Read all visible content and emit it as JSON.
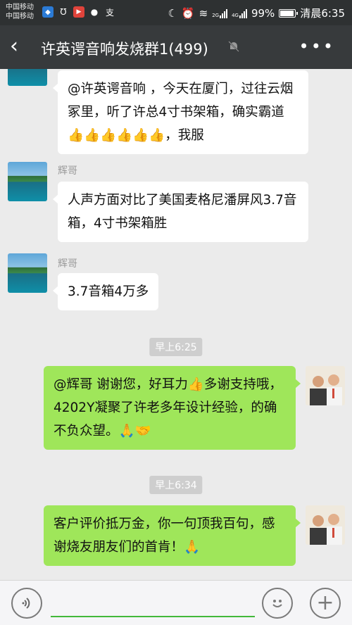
{
  "status_bar": {
    "carrier1": "中国移动",
    "carrier2": "中国移动",
    "left_icons": [
      "shield-icon",
      "spy-icon",
      "video-icon",
      "chat-icon",
      "alipay-icon"
    ],
    "net1": "2G",
    "net2": "4G",
    "battery": "99%",
    "battery_level": 0.99,
    "time": "清晨6:35"
  },
  "title_bar": {
    "back_icon": "back-arrow-icon",
    "title": "许英谔音响发烧群1(499)",
    "mute_icon": "mute-bell-icon",
    "more_icon": "more-dots-icon"
  },
  "messages": [
    {
      "type": "left",
      "sender": "",
      "text": "@许英谔音响 ，今天在厦门，过往云烟冢里，听了许总4寸书架箱，确实霸道👍👍👍👍👍👍，我服"
    },
    {
      "type": "left",
      "sender": "辉哥",
      "text": "人声方面对比了美国麦格尼潘屏风3.7音箱，4寸书架箱胜"
    },
    {
      "type": "left",
      "sender": "辉哥",
      "text": "3.7音箱4万多"
    },
    {
      "type": "time",
      "text": "早上6:25"
    },
    {
      "type": "right",
      "text": "@辉哥 谢谢您，好耳力👍多谢支持哦，4202Y凝聚了许老多年设计经验，的确不负众望。🙏🤝"
    },
    {
      "type": "time",
      "text": "早上6:34"
    },
    {
      "type": "right",
      "text": "客户评价抵万金，你一句顶我百句，感谢烧友朋友们的首肯！🙏"
    }
  ],
  "input_bar": {
    "voice_icon": "voice-icon",
    "text_value": "",
    "emoji_icon": "emoji-icon",
    "plus_icon": "plus-icon"
  },
  "colors": {
    "status_bar_bg": "#2e3132",
    "title_bar_bg": "#373a3c",
    "chat_bg": "#ebebeb",
    "bubble_left": "#ffffff",
    "bubble_right": "#9fe65a",
    "input_underline": "#42b83a"
  }
}
